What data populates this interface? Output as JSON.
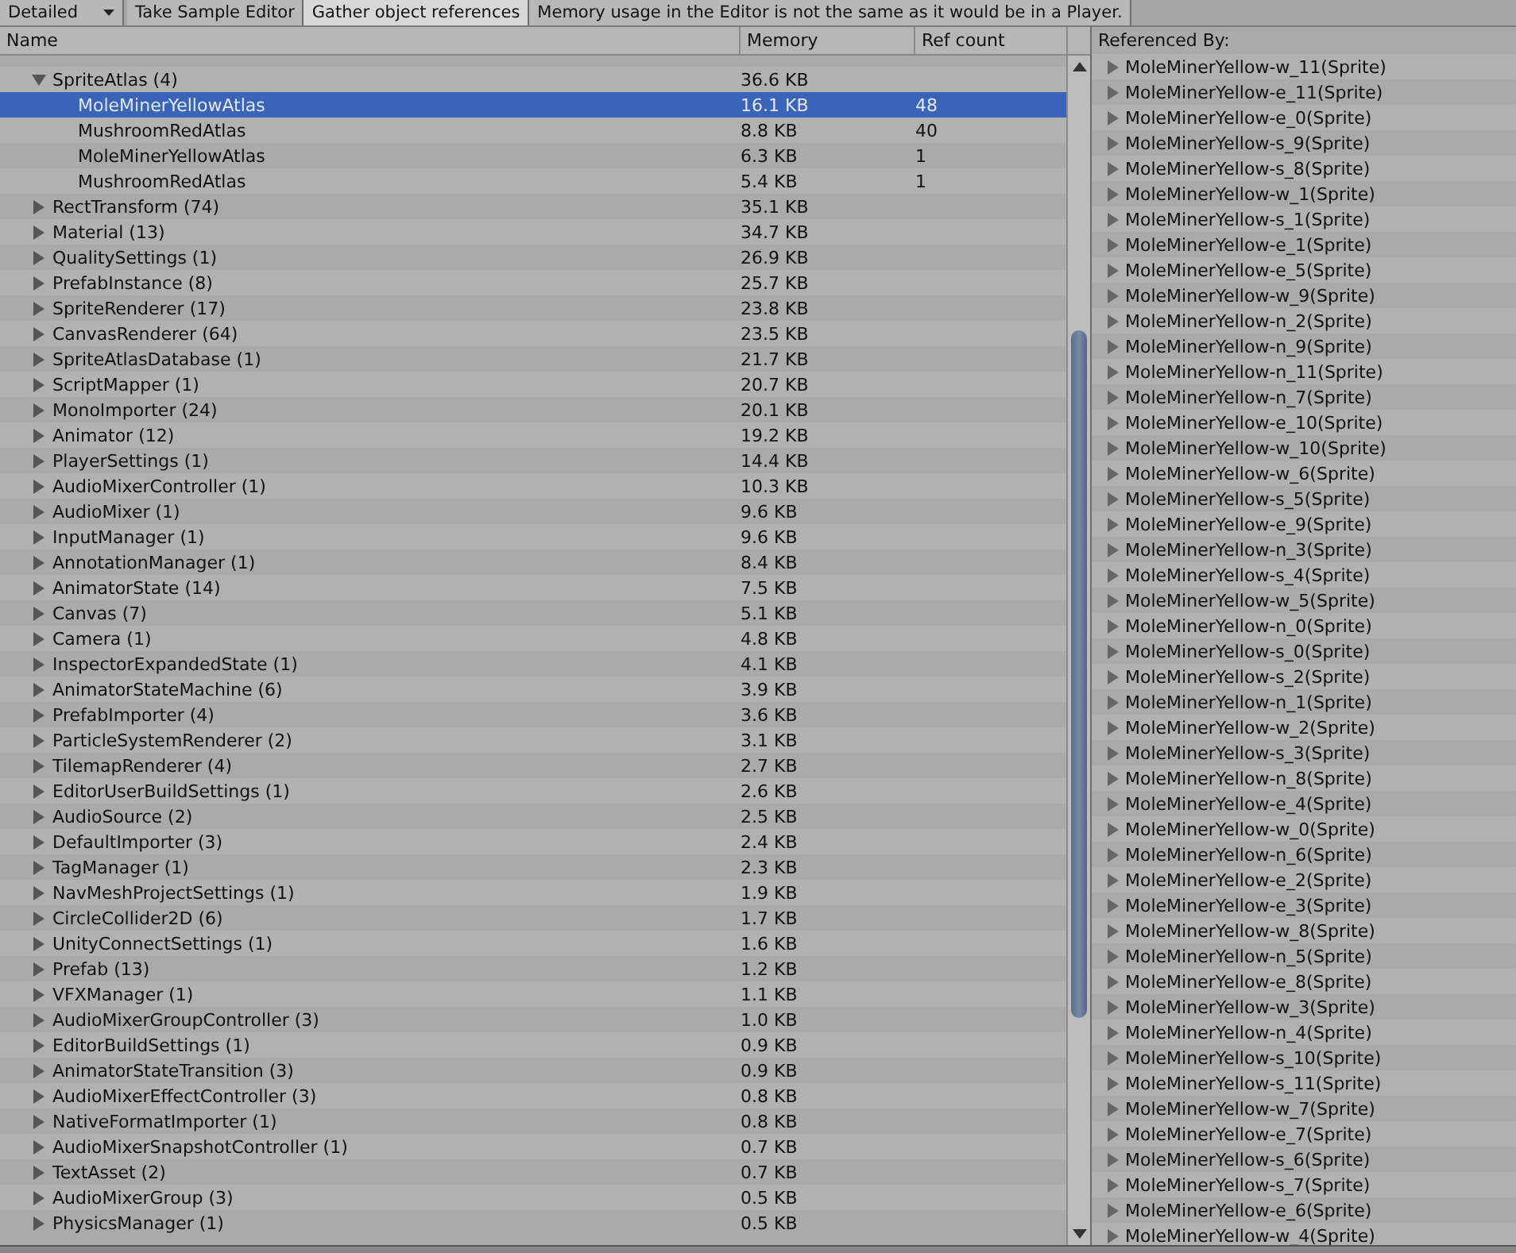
{
  "toolbar": [
    {
      "kind": "dropdown",
      "label": "Detailed",
      "on": false
    },
    {
      "kind": "button",
      "label": "Take Sample Editor",
      "on": false
    },
    {
      "kind": "button",
      "label": "Gather object references",
      "on": true
    },
    {
      "kind": "label",
      "label": "Memory usage in the Editor is not the same as it would be in a Player.",
      "on": false
    }
  ],
  "table": {
    "columns": [
      "Name",
      "Memory",
      "Ref count"
    ],
    "rows": [
      {
        "name": "SpriteAtlas (4)",
        "memory": "36.6 KB",
        "expanded": true,
        "selected": false,
        "children": [
          {
            "name": "MoleMinerYellowAtlas",
            "memory": "16.1 KB",
            "ref_count": "48",
            "selected": true
          },
          {
            "name": "MushroomRedAtlas",
            "memory": "8.8 KB",
            "ref_count": "40",
            "selected": false
          },
          {
            "name": "MoleMinerYellowAtlas",
            "memory": "6.3 KB",
            "ref_count": "1",
            "selected": false
          },
          {
            "name": "MushroomRedAtlas",
            "memory": "5.4 KB",
            "ref_count": "1",
            "selected": false
          }
        ]
      },
      {
        "name": "RectTransform (74)",
        "memory": "35.1 KB",
        "expanded": false,
        "selected": false
      },
      {
        "name": "Material (13)",
        "memory": "34.7 KB",
        "expanded": false,
        "selected": false
      },
      {
        "name": "QualitySettings (1)",
        "memory": "26.9 KB",
        "expanded": false,
        "selected": false
      },
      {
        "name": "PrefabInstance (8)",
        "memory": "25.7 KB",
        "expanded": false,
        "selected": false
      },
      {
        "name": "SpriteRenderer (17)",
        "memory": "23.8 KB",
        "expanded": false,
        "selected": false
      },
      {
        "name": "CanvasRenderer (64)",
        "memory": "23.5 KB",
        "expanded": false,
        "selected": false
      },
      {
        "name": "SpriteAtlasDatabase (1)",
        "memory": "21.7 KB",
        "expanded": false,
        "selected": false
      },
      {
        "name": "ScriptMapper (1)",
        "memory": "20.7 KB",
        "expanded": false,
        "selected": false
      },
      {
        "name": "MonoImporter (24)",
        "memory": "20.1 KB",
        "expanded": false,
        "selected": false
      },
      {
        "name": "Animator (12)",
        "memory": "19.2 KB",
        "expanded": false,
        "selected": false
      },
      {
        "name": "PlayerSettings (1)",
        "memory": "14.4 KB",
        "expanded": false,
        "selected": false
      },
      {
        "name": "AudioMixerController (1)",
        "memory": "10.3 KB",
        "expanded": false,
        "selected": false
      },
      {
        "name": "AudioMixer (1)",
        "memory": "9.6 KB",
        "expanded": false,
        "selected": false
      },
      {
        "name": "InputManager (1)",
        "memory": "9.6 KB",
        "expanded": false,
        "selected": false
      },
      {
        "name": "AnnotationManager (1)",
        "memory": "8.4 KB",
        "expanded": false,
        "selected": false
      },
      {
        "name": "AnimatorState (14)",
        "memory": "7.5 KB",
        "expanded": false,
        "selected": false
      },
      {
        "name": "Canvas (7)",
        "memory": "5.1 KB",
        "expanded": false,
        "selected": false
      },
      {
        "name": "Camera (1)",
        "memory": "4.8 KB",
        "expanded": false,
        "selected": false
      },
      {
        "name": "InspectorExpandedState (1)",
        "memory": "4.1 KB",
        "expanded": false,
        "selected": false
      },
      {
        "name": "AnimatorStateMachine (6)",
        "memory": "3.9 KB",
        "expanded": false,
        "selected": false
      },
      {
        "name": "PrefabImporter (4)",
        "memory": "3.6 KB",
        "expanded": false,
        "selected": false
      },
      {
        "name": "ParticleSystemRenderer (2)",
        "memory": "3.1 KB",
        "expanded": false,
        "selected": false
      },
      {
        "name": "TilemapRenderer (4)",
        "memory": "2.7 KB",
        "expanded": false,
        "selected": false
      },
      {
        "name": "EditorUserBuildSettings (1)",
        "memory": "2.6 KB",
        "expanded": false,
        "selected": false
      },
      {
        "name": "AudioSource (2)",
        "memory": "2.5 KB",
        "expanded": false,
        "selected": false
      },
      {
        "name": "DefaultImporter (3)",
        "memory": "2.4 KB",
        "expanded": false,
        "selected": false
      },
      {
        "name": "TagManager (1)",
        "memory": "2.3 KB",
        "expanded": false,
        "selected": false
      },
      {
        "name": "NavMeshProjectSettings (1)",
        "memory": "1.9 KB",
        "expanded": false,
        "selected": false
      },
      {
        "name": "CircleCollider2D (6)",
        "memory": "1.7 KB",
        "expanded": false,
        "selected": false
      },
      {
        "name": "UnityConnectSettings (1)",
        "memory": "1.6 KB",
        "expanded": false,
        "selected": false
      },
      {
        "name": "Prefab (13)",
        "memory": "1.2 KB",
        "expanded": false,
        "selected": false
      },
      {
        "name": "VFXManager (1)",
        "memory": "1.1 KB",
        "expanded": false,
        "selected": false
      },
      {
        "name": "AudioMixerGroupController (3)",
        "memory": "1.0 KB",
        "expanded": false,
        "selected": false
      },
      {
        "name": "EditorBuildSettings (1)",
        "memory": "0.9 KB",
        "expanded": false,
        "selected": false
      },
      {
        "name": "AnimatorStateTransition (3)",
        "memory": "0.9 KB",
        "expanded": false,
        "selected": false
      },
      {
        "name": "AudioMixerEffectController (3)",
        "memory": "0.8 KB",
        "expanded": false,
        "selected": false
      },
      {
        "name": "NativeFormatImporter (1)",
        "memory": "0.8 KB",
        "expanded": false,
        "selected": false
      },
      {
        "name": "AudioMixerSnapshotController (1)",
        "memory": "0.7 KB",
        "expanded": false,
        "selected": false
      },
      {
        "name": "TextAsset (2)",
        "memory": "0.7 KB",
        "expanded": false,
        "selected": false
      },
      {
        "name": "AudioMixerGroup (3)",
        "memory": "0.5 KB",
        "expanded": false,
        "selected": false
      },
      {
        "name": "PhysicsManager (1)",
        "memory": "0.5 KB",
        "expanded": false,
        "selected": false
      }
    ]
  },
  "referenced_by": {
    "title": "Referenced By:",
    "items": [
      "MoleMinerYellow-w_11(Sprite)",
      "MoleMinerYellow-e_11(Sprite)",
      "MoleMinerYellow-e_0(Sprite)",
      "MoleMinerYellow-s_9(Sprite)",
      "MoleMinerYellow-s_8(Sprite)",
      "MoleMinerYellow-w_1(Sprite)",
      "MoleMinerYellow-s_1(Sprite)",
      "MoleMinerYellow-e_1(Sprite)",
      "MoleMinerYellow-e_5(Sprite)",
      "MoleMinerYellow-w_9(Sprite)",
      "MoleMinerYellow-n_2(Sprite)",
      "MoleMinerYellow-n_9(Sprite)",
      "MoleMinerYellow-n_11(Sprite)",
      "MoleMinerYellow-n_7(Sprite)",
      "MoleMinerYellow-e_10(Sprite)",
      "MoleMinerYellow-w_10(Sprite)",
      "MoleMinerYellow-w_6(Sprite)",
      "MoleMinerYellow-s_5(Sprite)",
      "MoleMinerYellow-e_9(Sprite)",
      "MoleMinerYellow-n_3(Sprite)",
      "MoleMinerYellow-s_4(Sprite)",
      "MoleMinerYellow-w_5(Sprite)",
      "MoleMinerYellow-n_0(Sprite)",
      "MoleMinerYellow-s_0(Sprite)",
      "MoleMinerYellow-s_2(Sprite)",
      "MoleMinerYellow-n_1(Sprite)",
      "MoleMinerYellow-w_2(Sprite)",
      "MoleMinerYellow-s_3(Sprite)",
      "MoleMinerYellow-n_8(Sprite)",
      "MoleMinerYellow-e_4(Sprite)",
      "MoleMinerYellow-w_0(Sprite)",
      "MoleMinerYellow-n_6(Sprite)",
      "MoleMinerYellow-e_2(Sprite)",
      "MoleMinerYellow-e_3(Sprite)",
      "MoleMinerYellow-w_8(Sprite)",
      "MoleMinerYellow-n_5(Sprite)",
      "MoleMinerYellow-e_8(Sprite)",
      "MoleMinerYellow-w_3(Sprite)",
      "MoleMinerYellow-n_4(Sprite)",
      "MoleMinerYellow-s_10(Sprite)",
      "MoleMinerYellow-s_11(Sprite)",
      "MoleMinerYellow-w_7(Sprite)",
      "MoleMinerYellow-e_7(Sprite)",
      "MoleMinerYellow-s_6(Sprite)",
      "MoleMinerYellow-s_7(Sprite)",
      "MoleMinerYellow-e_6(Sprite)",
      "MoleMinerYellow-w_4(Sprite)"
    ]
  }
}
